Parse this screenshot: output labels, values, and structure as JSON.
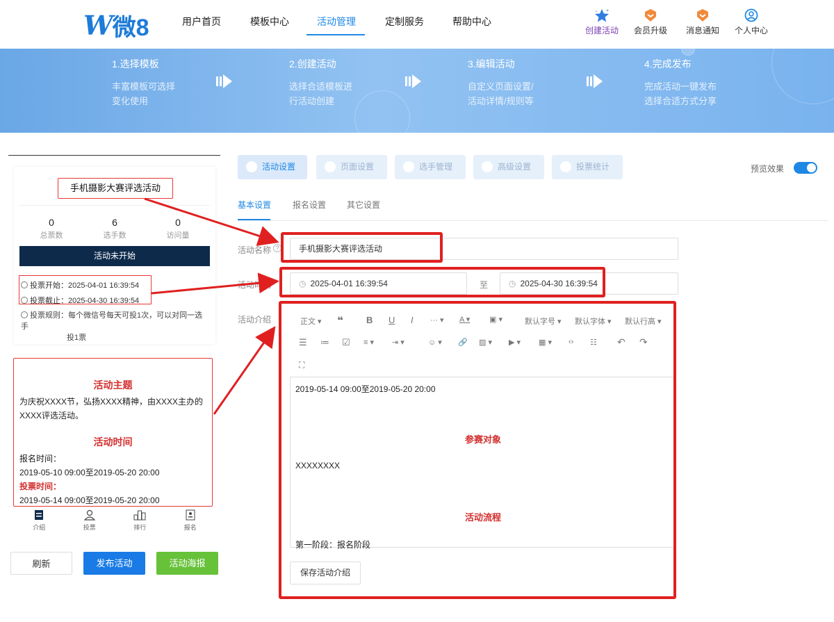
{
  "header": {
    "logo_w": "W",
    "logo_text": "微8",
    "nav": [
      "用户首页",
      "模板中心",
      "活动管理",
      "定制服务",
      "帮助中心"
    ],
    "actions": [
      "创建活动",
      "会员升级",
      "消息通知",
      "个人中心"
    ]
  },
  "banner": {
    "steps": [
      {
        "title": "1.选择模板",
        "desc1": "丰富模板可选择",
        "desc2": "变化使用"
      },
      {
        "title": "2.创建活动",
        "desc1": "选择合适模板进",
        "desc2": "行活动创建"
      },
      {
        "title": "3.编辑活动",
        "desc1": "自定义页面设置/",
        "desc2": "活动详情/规则等"
      },
      {
        "title": "4.完成发布",
        "desc1": "完成活动一键发布",
        "desc2": "选择合适方式分享"
      }
    ]
  },
  "preview": {
    "title": "手机摄影大赛评选活动",
    "stats": [
      {
        "value": "0",
        "label": "总票数"
      },
      {
        "value": "6",
        "label": "选手数"
      },
      {
        "value": "0",
        "label": "访问量"
      }
    ],
    "status": "活动未开始",
    "vote_start": "投票开始：2025-04-01 16:39:54",
    "vote_end": "投票截止：2025-04-30 16:39:54",
    "rule_prefix": "投票规则：",
    "rule_line1": "每个微信号每天可投1次，可以对同一选手",
    "rule_line2": "投1票",
    "intro_theme_h": "活动主题",
    "intro_theme_p": "为庆祝XXXX节，弘扬XXXX精神，由XXXX主办的XXXX评选活动。",
    "intro_time_h": "活动时间",
    "intro_signup_label": "报名时间：",
    "intro_signup_time": "2019-05-10 09:00至2019-05-20 20:00",
    "intro_vote_label": "投票时间：",
    "intro_vote_time": "2019-05-14 09:00至2019-05-20 20:00",
    "tabs": [
      "介绍",
      "投票",
      "排行",
      "报名"
    ],
    "buttons": {
      "refresh": "刷新",
      "publish": "发布活动",
      "poster": "活动海报"
    }
  },
  "settings": {
    "tabs": [
      "活动设置",
      "页面设置",
      "选手管理",
      "高级设置",
      "投票统计"
    ],
    "preview_label": "预览效果",
    "subtabs": [
      "基本设置",
      "报名设置",
      "其它设置"
    ],
    "name_label": "活动名称",
    "name_value": "手机摄影大赛评选活动",
    "time_label": "活动时间",
    "start_time": "2025-04-01 16:39:54",
    "to_label": "至",
    "end_time": "2025-04-30 16:39:54",
    "intro_label": "活动介绍",
    "toolbar": {
      "paragraph": "正文",
      "font_size": "默认字号",
      "font_family": "默认字体",
      "line_height": "默认行高"
    },
    "editor": {
      "line1": "2019-05-14 09:00至2019-05-20 20:00",
      "h1": "参赛对象",
      "p1": "XXXXXXXX",
      "h2": "活动流程",
      "p2": "第一阶段：报名阶段"
    },
    "save_label": "保存活动介绍"
  },
  "colors": {
    "accent": "#1e88e5",
    "annotation": "#e02020",
    "status_bar": "#0d2a4a",
    "poster_btn": "#67c23a"
  }
}
